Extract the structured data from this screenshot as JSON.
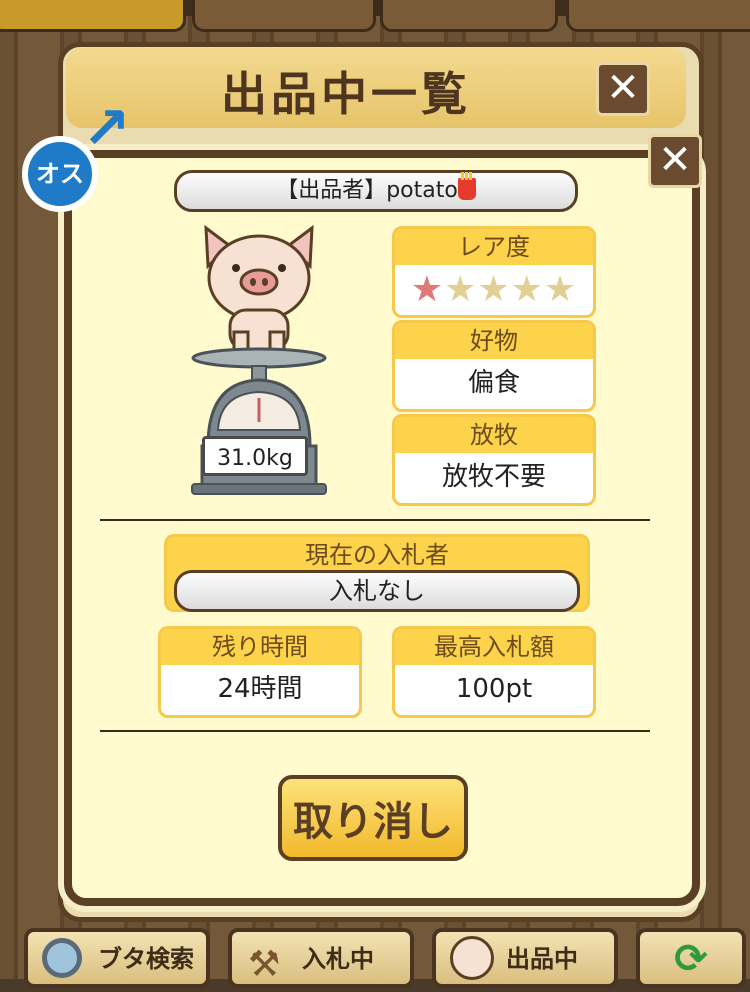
{
  "window": {
    "title": "出品中一覧"
  },
  "listing": {
    "seller_label": "【出品者】potato",
    "gender_badge": "オス",
    "weight": "31.0kg",
    "rarity": {
      "label": "レア度",
      "stars": 1,
      "max": 5
    },
    "favorite": {
      "label": "好物",
      "value": "偏食"
    },
    "grazing": {
      "label": "放牧",
      "value": "放牧不要"
    },
    "current_bidder": {
      "label": "現在の入札者",
      "value": "入札なし"
    },
    "time_left": {
      "label": "残り時間",
      "value": "24時間"
    },
    "highest_bid": {
      "label": "最高入札額",
      "value": "100pt"
    },
    "cancel_label": "取り消し"
  },
  "icons": {
    "close": "close-icon",
    "male": "male-icon",
    "fries": "fries-icon",
    "scale": "scale-icon",
    "pig": "pig-icon"
  },
  "bottom_nav": {
    "search": "ブタ検索",
    "bidding": "入札中",
    "listing": "出品中"
  },
  "colors": {
    "accent": "#fcd34b",
    "frame": "#5a3f24",
    "male": "#1f7bc8",
    "star_on": "#e07a7a"
  }
}
